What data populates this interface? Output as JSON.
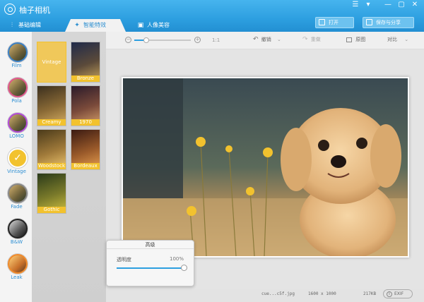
{
  "app": {
    "title": "柚子相机"
  },
  "window_controls": {
    "menu": "☰",
    "dropdown": "▾",
    "minimize": "—",
    "maximize": "▢",
    "close": "✕"
  },
  "tabs": [
    {
      "label": "基础编辑",
      "icon": "sliders-icon"
    },
    {
      "label": "智能特效",
      "icon": "magic-wand-icon",
      "active": true
    },
    {
      "label": "人像美容",
      "icon": "portrait-icon"
    }
  ],
  "topbar": {
    "open_label": "打开",
    "save_share_label": "保存与分享"
  },
  "toolbar": {
    "zoom_level": "1:1",
    "undo_label": "撤销",
    "redo_label": "重做",
    "original_label": "原图",
    "compare_label": "对比"
  },
  "categories": [
    {
      "label": "Film"
    },
    {
      "label": "Pola"
    },
    {
      "label": "LOMO"
    },
    {
      "label": "Vintage",
      "selected": true
    },
    {
      "label": "Fade"
    },
    {
      "label": "B&W"
    },
    {
      "label": "Leak"
    }
  ],
  "filters": [
    {
      "label": "Vintage",
      "selected": true
    },
    {
      "label": "Bronze"
    },
    {
      "label": "Creamy"
    },
    {
      "label": "1970"
    },
    {
      "label": "Woodstock"
    },
    {
      "label": "Bordeaux"
    },
    {
      "label": "Gothic"
    }
  ],
  "advanced_panel": {
    "title": "高级",
    "slider_label": "透明度",
    "slider_value_text": "100%",
    "slider_value": 1.0
  },
  "status": {
    "filename": "cue...c5f.jpg",
    "dimensions": "1600 x 1000",
    "filesize": "217KB",
    "exif_label": "EXIF"
  },
  "colors": {
    "accent": "#2d9fe0",
    "selected_yellow": "#f2c22e",
    "link_blue": "#2e8fd3"
  }
}
